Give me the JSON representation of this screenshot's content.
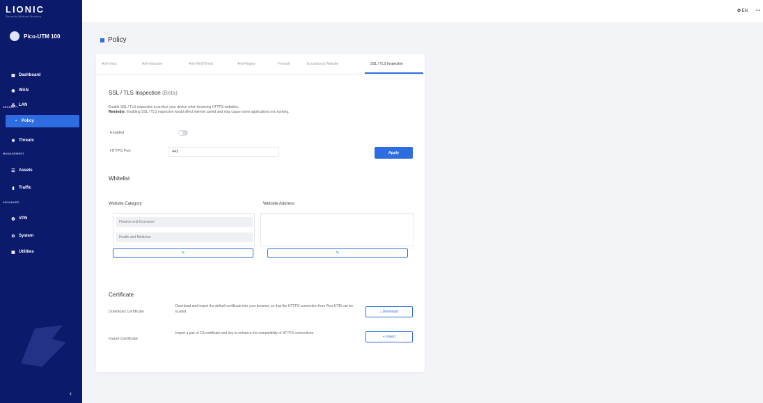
{
  "brand": {
    "name": "LIONIC",
    "tagline": "Security Without Borders"
  },
  "device": {
    "name": "Pico-UTM 100"
  },
  "nav": {
    "dashboard": "Dashboard",
    "wan": "WAN",
    "lan": "LAN",
    "section_security": "SECURITY",
    "policy": "Policy",
    "threats": "Threats",
    "section_management": "MANAGEMENT",
    "assets": "Assets",
    "traffic": "Traffic",
    "section_advanced": "ADVANCED",
    "vpn": "VPN",
    "system": "System",
    "utilities": "Utilities",
    "collapse": "‹"
  },
  "topbar": {
    "language": "EN",
    "logout": "↦"
  },
  "page": {
    "title": "Policy"
  },
  "tabs": [
    "Anti-Virus",
    "Anti-Intrusion",
    "Anti-WebThreat",
    "Anti-Region",
    "Firewall",
    "Exceptional Website",
    "SSL / TLS Inspection"
  ],
  "ssl": {
    "heading": "SSL / TLS Inspection",
    "beta": "(Beta)",
    "desc": "Enable SSL / TLS inspection to protect your device when browsing HTTPS websites.",
    "reminder_label": "Reminder:",
    "reminder_text": " Enabling SSL / TLS inspection would affect internet speed and may cause some applications not working.",
    "enabled_label": "Enabled",
    "port_label": "HTTPS Port",
    "port_value": "443",
    "apply": "Apply"
  },
  "whitelist": {
    "heading": "Whitelist",
    "category_label": "Website Category",
    "address_label": "Website Address",
    "categories": [
      "Finance and Insurance",
      "Health and Medicine"
    ],
    "edit_icon": "✎"
  },
  "certificate": {
    "heading": "Certificate",
    "download_label": "Download Certificate",
    "download_desc": "Download and import the default certificate into your browser, so that the HTTPS connection from Pico-UTM can be trusted.",
    "download_btn": "⤓ Download",
    "import_label": "Import Certificate",
    "import_desc": "Import a pair of CA certificate and key to enhance the compatibility of HTTPS connections.",
    "import_btn": "+ Import"
  }
}
